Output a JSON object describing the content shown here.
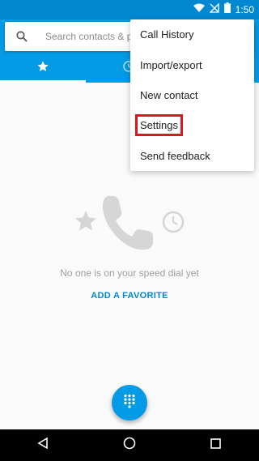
{
  "status_bar": {
    "time": "1:50"
  },
  "search": {
    "placeholder": "Search contacts & pla"
  },
  "menu": {
    "items": [
      {
        "label": "Call History"
      },
      {
        "label": "Import/export"
      },
      {
        "label": "New contact"
      },
      {
        "label": "Settings"
      },
      {
        "label": "Send feedback"
      }
    ]
  },
  "empty_state": {
    "message": "No one is on your speed dial yet",
    "action": "ADD A FAVORITE"
  },
  "colors": {
    "appbar": "#039be5",
    "status_bar": "#0288d1",
    "highlight_box": "#e5131a",
    "accent_text": "#0288d1"
  },
  "icons": {
    "tab_favorites": "star-icon",
    "tab_recents": "clock-icon",
    "fab": "dialpad-icon",
    "nav_back": "back-triangle-icon",
    "nav_home": "home-circle-icon",
    "nav_recents": "recents-square-icon"
  }
}
